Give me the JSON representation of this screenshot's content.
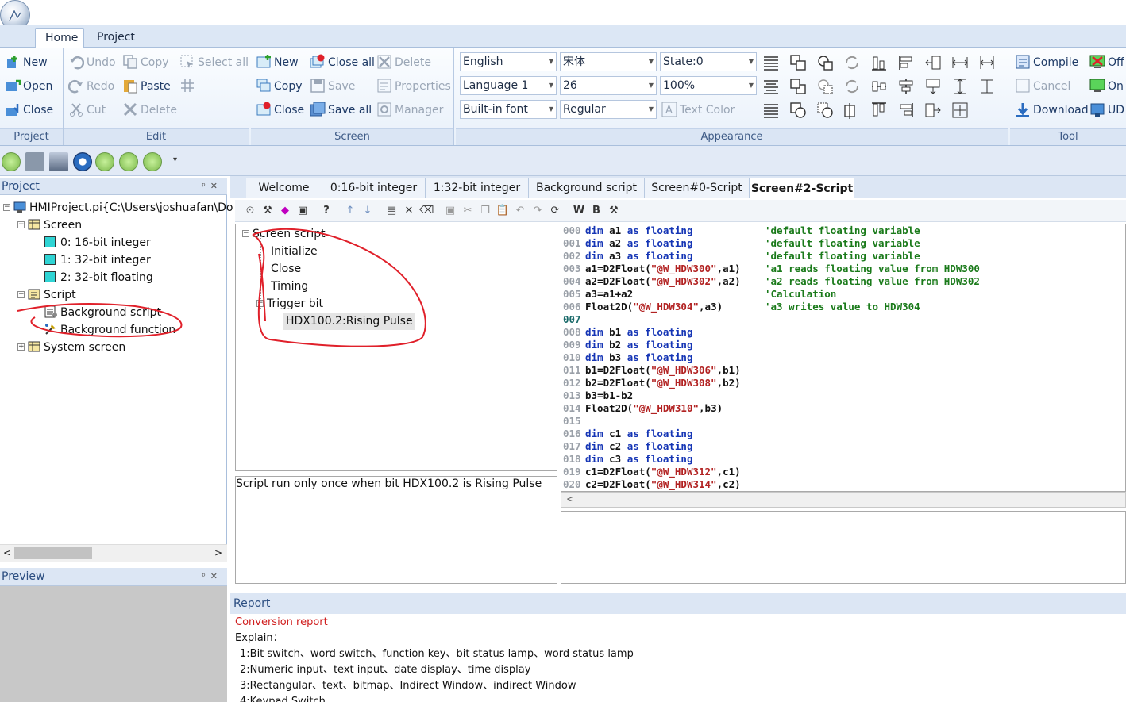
{
  "ribbon_tabs": [
    "Home",
    "Project"
  ],
  "groups": {
    "project": {
      "title": "Project",
      "buttons": [
        "New",
        "Open",
        "Close"
      ]
    },
    "edit": {
      "title": "Edit",
      "col1": [
        "Undo",
        "Redo",
        "Cut"
      ],
      "col2": [
        "Copy",
        "Paste",
        "Delete"
      ],
      "col3": [
        "Select all"
      ]
    },
    "screen": {
      "title": "Screen",
      "col1": [
        "New",
        "Copy",
        "Close"
      ],
      "col2": [
        "Close all",
        "Save",
        "Save all"
      ],
      "col3": [
        "Delete",
        "Properties",
        "Manager"
      ]
    },
    "appearance": {
      "title": "Appearance",
      "combos": {
        "language": "English",
        "language_no": "Language 1",
        "font_type": "Built-in font",
        "font": "宋体",
        "size": "26",
        "style": "Regular",
        "state": "State:0",
        "zoom": "100%"
      },
      "text_color": "Text Color"
    },
    "tool": {
      "title": "Tool",
      "buttons": [
        "Compile",
        "Cancel",
        "Download"
      ],
      "col2": [
        "Off",
        "On",
        "UD"
      ]
    }
  },
  "project_panel": {
    "title": "Project",
    "root": "HMIProject.pi{C:\\Users\\joshuafan\\Do",
    "screen": "Screen",
    "screens": [
      "0: 16-bit integer",
      "1: 32-bit integer",
      "2: 32-bit floating"
    ],
    "script": "Script",
    "scripts": [
      "Background script",
      "Background function"
    ],
    "system": "System screen"
  },
  "preview_panel": {
    "title": "Preview"
  },
  "doc_tabs": [
    "Welcome",
    "0:16-bit integer",
    "1:32-bit integer",
    "Background script",
    "Screen#0-Script",
    "Screen#2-Script"
  ],
  "script_tree": {
    "root": "Screen script",
    "items": [
      "Initialize",
      "Close",
      "Timing",
      "Trigger bit"
    ],
    "child": "HDX100.2:Rising Pulse"
  },
  "script_desc": "Script run only once when bit HDX100.2 is Rising Pulse",
  "toolbar_letters": [
    "W",
    "B"
  ],
  "code_lines": [
    {
      "n": "000",
      "a": "dim a1 ",
      "k": "as floating",
      "c": "'default floating variable"
    },
    {
      "n": "001",
      "a": "dim a2 ",
      "k": "as floating",
      "c": "'default floating variable"
    },
    {
      "n": "002",
      "a": "dim a3 ",
      "k": "as floating",
      "c": "'default floating variable"
    },
    {
      "n": "003",
      "p": "a1=D2Float(",
      "s": "\"@W_HDW300\"",
      "q": ",a1)",
      "c": "'a1 reads floating value from HDW300"
    },
    {
      "n": "004",
      "p": "a2=D2Float(",
      "s": "\"@W_HDW302\"",
      "q": ",a2)",
      "c": "'a2 reads floating value from HDW302"
    },
    {
      "n": "005",
      "p": "a3=a1+a2",
      "c": "'Calculation"
    },
    {
      "n": "006",
      "p": "Float2D(",
      "s": "\"@W_HDW304\"",
      "q": ",a3)",
      "c": "'a3 writes value to HDW304"
    },
    {
      "n": "007"
    },
    {
      "n": "008",
      "a": "dim b1 ",
      "k": "as floating"
    },
    {
      "n": "009",
      "a": "dim b2 ",
      "k": "as floating"
    },
    {
      "n": "010",
      "a": "dim b3 ",
      "k": "as floating"
    },
    {
      "n": "011",
      "p": "b1=D2Float(",
      "s": "\"@W_HDW306\"",
      "q": ",b1)"
    },
    {
      "n": "012",
      "p": "b2=D2Float(",
      "s": "\"@W_HDW308\"",
      "q": ",b2)"
    },
    {
      "n": "013",
      "p": "b3=b1-b2"
    },
    {
      "n": "014",
      "p": "Float2D(",
      "s": "\"@W_HDW310\"",
      "q": ",b3)"
    },
    {
      "n": "015"
    },
    {
      "n": "016",
      "a": "dim c1 ",
      "k": "as floating"
    },
    {
      "n": "017",
      "a": "dim c2 ",
      "k": "as floating"
    },
    {
      "n": "018",
      "a": "dim c3 ",
      "k": "as floating"
    },
    {
      "n": "019",
      "p": "c1=D2Float(",
      "s": "\"@W_HDW312\"",
      "q": ",c1)"
    },
    {
      "n": "020",
      "p": "c2=D2Float(",
      "s": "\"@W_HDW314\"",
      "q": ",c2)"
    }
  ],
  "report": {
    "title": "Report",
    "heading": "Conversion report",
    "explain": "Explain：",
    "lines": [
      "1:Bit switch、word switch、function key、bit status lamp、word status lamp",
      "2:Numeric input、text input、date display、time display",
      "3:Rectangular、text、bitmap、Indirect Window、indirect Window",
      "4:Keypad Switch"
    ]
  },
  "colors": {
    "accent": "#2b4d80",
    "annotation": "#e0202a",
    "ribbon_bg": "#dce7f5"
  }
}
